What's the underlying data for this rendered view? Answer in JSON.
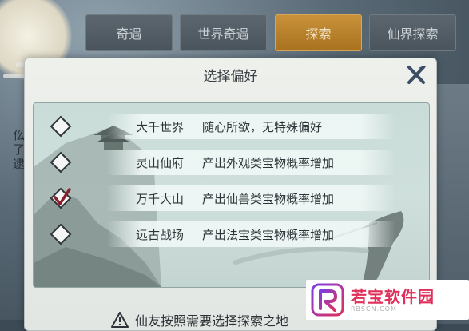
{
  "tabs": [
    {
      "label": "奇遇",
      "active": false
    },
    {
      "label": "世界奇遇",
      "active": false
    },
    {
      "label": "探索",
      "active": true
    },
    {
      "label": "仙界探索",
      "active": false
    }
  ],
  "dialog": {
    "title": "选择偏好",
    "close_icon": "close-x-icon",
    "options": [
      {
        "name": "大千世界",
        "description": "随心所欲，无特殊偏好",
        "checked": false
      },
      {
        "name": "灵山仙府",
        "description": "产出外观类宝物概率增加",
        "checked": false
      },
      {
        "name": "万千大山",
        "description": "产出仙兽类宝物概率增加",
        "checked": true
      },
      {
        "name": "远古战场",
        "description": "产出法宝类宝物概率增加",
        "checked": false
      }
    ],
    "warning_text": "仙友按照需要选择探索之地"
  },
  "background": {
    "left_text": [
      "仫",
      "了",
      "逮"
    ]
  },
  "watermark": {
    "main": "若宝软件园",
    "sub": "RBSCN.COM"
  },
  "colors": {
    "active_tab": "#b57d2a",
    "inactive_tab": "#525c64",
    "checkmark": "#8a1f2b"
  }
}
